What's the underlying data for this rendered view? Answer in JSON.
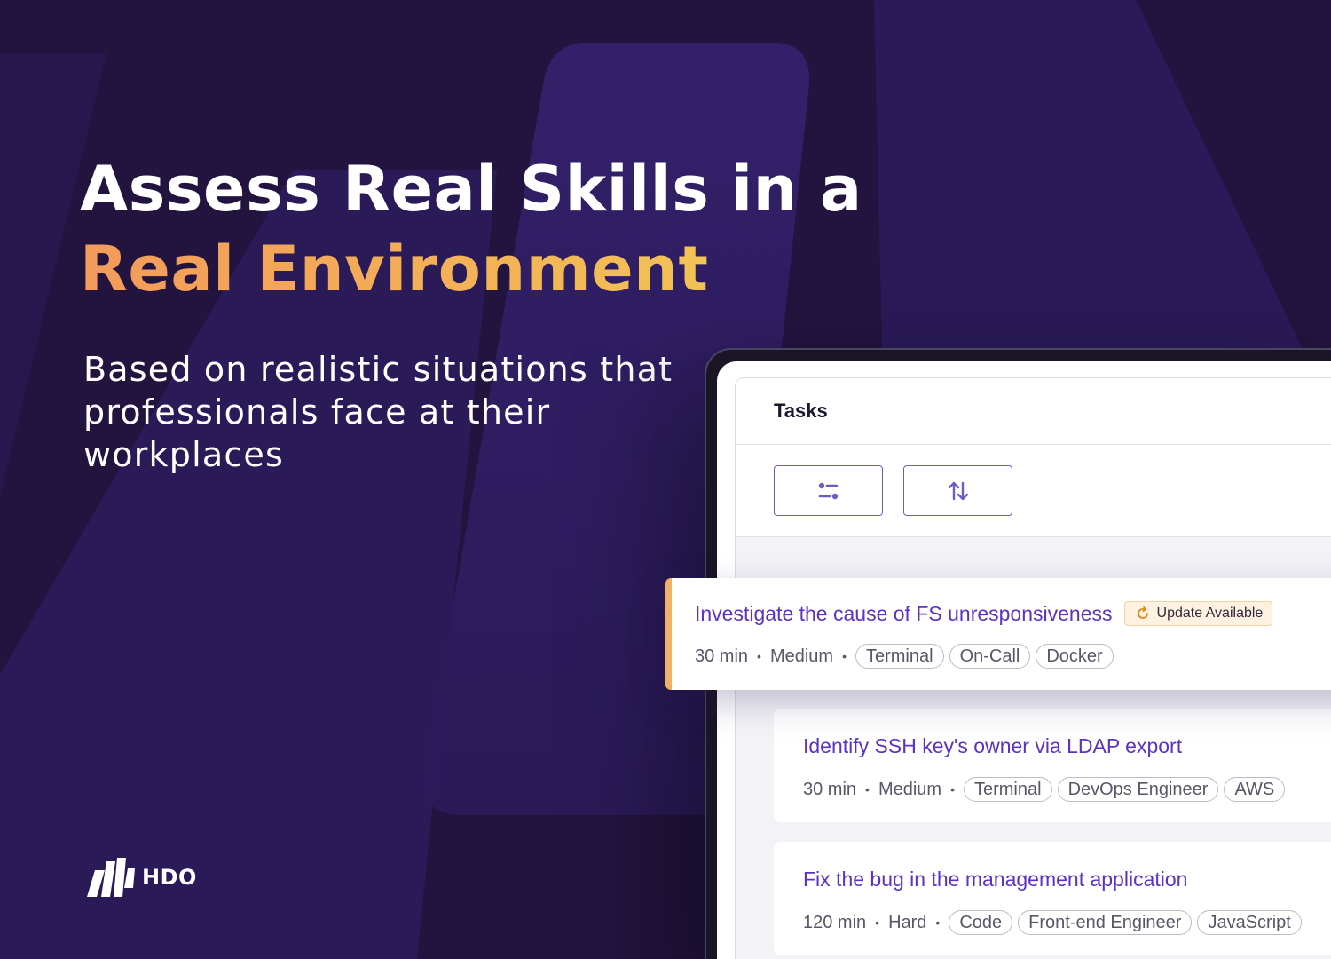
{
  "hero": {
    "title_line1": "Assess Real Skills in a",
    "title_line2": "Real Environment",
    "subtitle": "Based on realistic situations that professionals face at their workplaces"
  },
  "brand": {
    "name": "HDO",
    "logo_icon": "hdo-logo-icon"
  },
  "colors": {
    "background": "#22143f",
    "accent_gradient": [
      "#f39a5c",
      "#f0cf55"
    ],
    "task_title": "#5b32c4",
    "update_badge_bg": "#fdf2e0",
    "featured_border": "#efb167"
  },
  "panel": {
    "title": "Tasks",
    "toolbar": [
      {
        "icon": "filter-icon"
      },
      {
        "icon": "sort-icon"
      }
    ]
  },
  "tasks": [
    {
      "title": "Investigate the cause of FS unresponsiveness",
      "badge": {
        "icon": "refresh-icon",
        "label": "Update Available"
      },
      "duration": "30 min",
      "difficulty": "Medium",
      "tags": [
        "Terminal",
        "On-Call",
        "Docker"
      ]
    },
    {
      "title": "Identify SSH key's owner via LDAP export",
      "duration": "30 min",
      "difficulty": "Medium",
      "tags": [
        "Terminal",
        "DevOps Engineer",
        "AWS"
      ]
    },
    {
      "title": "Fix the bug in the management application",
      "duration": "120 min",
      "difficulty": "Hard",
      "tags": [
        "Code",
        "Front-end Engineer",
        "JavaScript"
      ]
    }
  ]
}
